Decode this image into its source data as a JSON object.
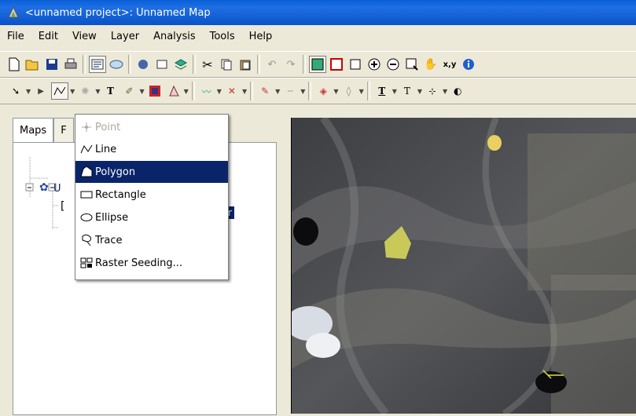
{
  "window": {
    "title": "<unnamed project>: Unnamed Map"
  },
  "menubar": {
    "items": [
      "File",
      "Edit",
      "View",
      "Layer",
      "Analysis",
      "Tools",
      "Help"
    ]
  },
  "toolbar1": {
    "coord_button_label": "x,y"
  },
  "left_panel": {
    "tabs": [
      {
        "label": "Maps"
      },
      {
        "label": "F"
      }
    ],
    "tree": {
      "node1_label": "U",
      "selected_fragment": "r"
    }
  },
  "dropdown_menu": {
    "items": [
      {
        "label": "Point",
        "icon": "point-icon",
        "state": "disabled"
      },
      {
        "label": "Line",
        "icon": "line-icon",
        "state": "normal"
      },
      {
        "label": "Polygon",
        "icon": "polygon-icon",
        "state": "highlighted"
      },
      {
        "label": "Rectangle",
        "icon": "rectangle-icon",
        "state": "normal"
      },
      {
        "label": "Ellipse",
        "icon": "ellipse-icon",
        "state": "normal"
      },
      {
        "label": "Trace",
        "icon": "trace-icon",
        "state": "normal"
      },
      {
        "label": "Raster Seeding...",
        "icon": "raster-seeding-icon",
        "state": "normal"
      }
    ]
  },
  "colors": {
    "titlebar": "#0a5fd8",
    "highlight": "#0a246a",
    "chrome": "#ece9d8"
  }
}
